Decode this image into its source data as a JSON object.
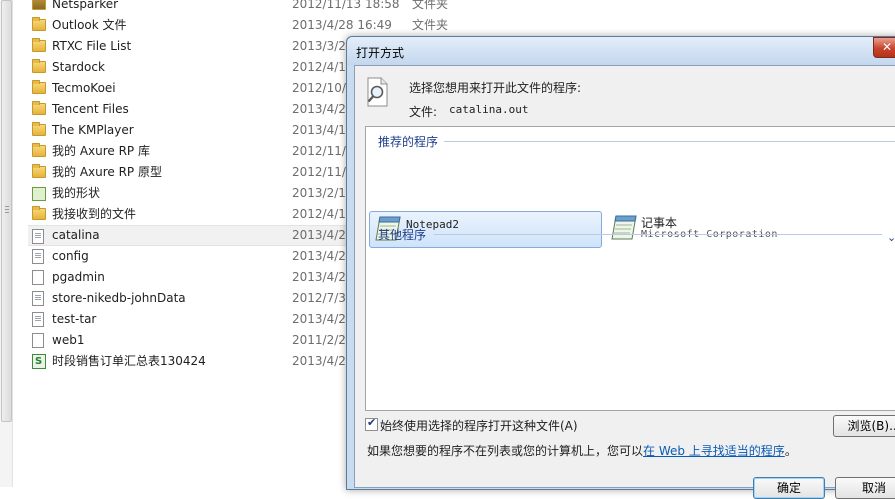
{
  "file_list": [
    {
      "name": "Netsparker",
      "date": "2012/11/13 18:58",
      "type": "文件夹",
      "icon": "folder-dark-icon"
    },
    {
      "name": "Outlook 文件",
      "date": "2013/4/28 16:49",
      "type": "文件夹",
      "icon": "folder-icon"
    },
    {
      "name": "RTXC File List",
      "date": "2013/3/2",
      "type": "",
      "icon": "folder-icon"
    },
    {
      "name": "Stardock",
      "date": "2012/4/1",
      "type": "",
      "icon": "folder-icon"
    },
    {
      "name": "TecmoKoei",
      "date": "2012/10/1",
      "type": "",
      "icon": "folder-icon"
    },
    {
      "name": "Tencent Files",
      "date": "2013/4/2",
      "type": "",
      "icon": "folder-icon"
    },
    {
      "name": "The KMPlayer",
      "date": "2013/4/1",
      "type": "",
      "icon": "folder-icon"
    },
    {
      "name": "我的 Axure RP 库",
      "date": "2012/11/2",
      "type": "",
      "icon": "folder-icon"
    },
    {
      "name": "我的 Axure RP 原型",
      "date": "2012/11/2",
      "type": "",
      "icon": "folder-icon"
    },
    {
      "name": "我的形状",
      "date": "2013/2/1",
      "type": "",
      "icon": "shapes-folder-icon"
    },
    {
      "name": "我接收到的文件",
      "date": "2012/4/1",
      "type": "",
      "icon": "folder-icon"
    },
    {
      "name": "catalina",
      "date": "2013/4/2",
      "type": "",
      "icon": "text-file-icon",
      "selected": true
    },
    {
      "name": "config",
      "date": "2013/4/2",
      "type": "",
      "icon": "text-file-icon"
    },
    {
      "name": "pgadmin",
      "date": "2013/4/2",
      "type": "",
      "icon": "blank-file-icon"
    },
    {
      "name": "store-nikedb-johnData",
      "date": "2012/7/3",
      "type": "",
      "icon": "text-file-icon"
    },
    {
      "name": "test-tar",
      "date": "2013/4/2",
      "type": "",
      "icon": "text-file-icon"
    },
    {
      "name": "web1",
      "date": "2011/2/2",
      "type": "",
      "icon": "blank-file-icon"
    },
    {
      "name": "时段销售订单汇总表130424",
      "date": "2013/4/2",
      "type": "",
      "icon": "spreadsheet-icon"
    }
  ],
  "dialog": {
    "title": "打开方式",
    "close_symbol": "✕",
    "prompt": "选择您想用来打开此文件的程序:",
    "file_label": "文件:",
    "file_name": "catalina.out",
    "recommended_header": "推荐的程序",
    "programs": [
      {
        "name": "Notepad2",
        "vendor": "",
        "selected": true,
        "icon": "notepad2-icon"
      },
      {
        "name": "记事本",
        "vendor": "Microsoft Corporation",
        "selected": false,
        "icon": "notepad-icon"
      }
    ],
    "other_header": "其他程序",
    "always_use_label": "始终使用选择的程序打开这种文件(A)",
    "always_use_checked": true,
    "browse_button": "浏览(B)...",
    "help_text": "如果您想要的程序不在列表或您的计算机上，您可以",
    "help_link": "在 Web 上寻找适当的程序",
    "help_suffix": "。",
    "ok_button": "确定",
    "cancel_button": "取消"
  },
  "colors": {
    "link": "#0a5bb5",
    "group_header": "#1e3e8a",
    "dialog_frame": "#c9dbee",
    "close_button": "#c8432b",
    "selection": "#cfe3f9"
  }
}
